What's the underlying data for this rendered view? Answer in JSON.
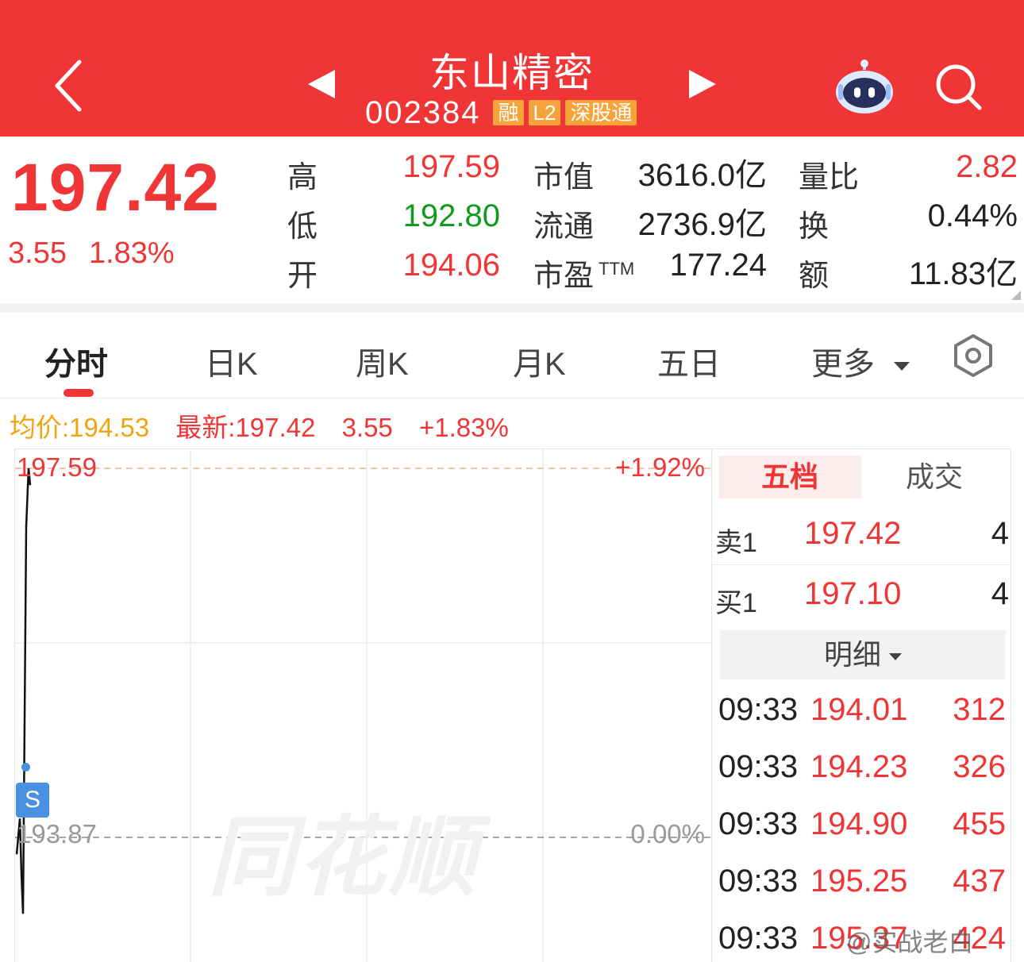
{
  "header": {
    "stock_name": "东山精密",
    "stock_code": "002384",
    "tags": [
      "融",
      "L2",
      "深股通"
    ]
  },
  "quote": {
    "price": "197.42",
    "change": "3.55",
    "change_pct": "1.83%",
    "high_label": "高",
    "high": "197.59",
    "low_label": "低",
    "low": "192.80",
    "open_label": "开",
    "open": "194.06",
    "mktcap_label": "市值",
    "mktcap": "3616.0亿",
    "float_label": "流通",
    "float_cap": "2736.9亿",
    "pe_label": "市盈",
    "pe_sup": "TTM",
    "pe": "177.24",
    "vol_ratio_label": "量比",
    "vol_ratio": "2.82",
    "turnover_label": "换",
    "turnover": "0.44%",
    "amount_label": "额",
    "amount": "11.83亿"
  },
  "tabs": [
    "分时",
    "日K",
    "周K",
    "月K",
    "五日",
    "更多"
  ],
  "info_line": {
    "avg_label": "均价:194.53",
    "latest_label": "最新:197.42",
    "change": "3.55",
    "change_pct": "+1.83%"
  },
  "chart": {
    "top_price": "197.59",
    "top_pct": "+1.92%",
    "base_price": "193.87",
    "base_pct": "0.00%",
    "watermark": "同花顺",
    "badge": "S"
  },
  "chart_data": {
    "type": "line",
    "title": "",
    "ylim": [
      193.87,
      197.59
    ],
    "reference_price": 193.87,
    "series": [
      {
        "values": [
          193.7,
          194.06,
          193.5,
          193.1,
          197.0,
          197.59,
          197.42
        ]
      }
    ]
  },
  "panel": {
    "tab_active": "五档",
    "tab_other": "成交",
    "sell1": {
      "label": "卖1",
      "price": "197.42",
      "qty": "4"
    },
    "buy1": {
      "label": "买1",
      "price": "197.10",
      "qty": "4"
    },
    "detail_label": "明细",
    "trades": [
      {
        "time": "09:33",
        "price": "194.01",
        "vol": "312"
      },
      {
        "time": "09:33",
        "price": "194.23",
        "vol": "326"
      },
      {
        "time": "09:33",
        "price": "194.90",
        "vol": "455"
      },
      {
        "time": "09:33",
        "price": "195.25",
        "vol": "437"
      },
      {
        "time": "09:33",
        "price": "195.37",
        "vol": "424"
      }
    ]
  },
  "watermark_text": "@实战老白",
  "colors": {
    "up_red": "#ef3535",
    "down_green": "#119a1e",
    "avg_orange": "#f0a410",
    "header_red": "#ef3535"
  }
}
